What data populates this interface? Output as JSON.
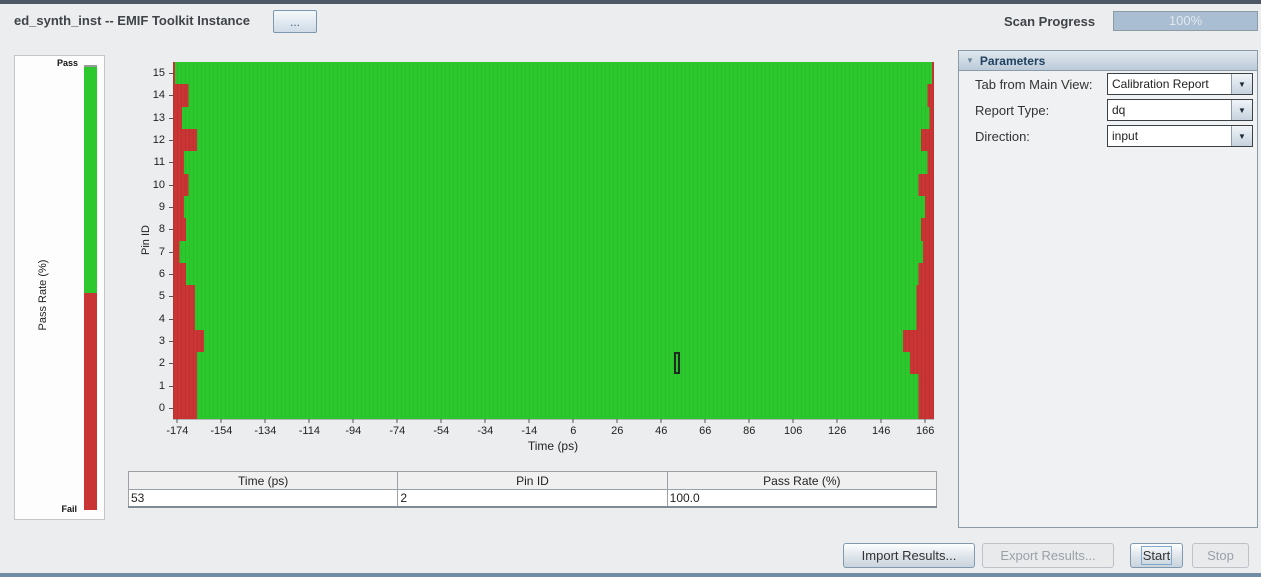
{
  "window": {
    "title": "ed_synth_inst -- EMIF Toolkit Instance",
    "more_button": "...",
    "scan_progress": {
      "label": "Scan Progress",
      "value": "100%",
      "percent": 100
    }
  },
  "legend": {
    "pass_label": "Pass",
    "fail_label": "Fail",
    "axis_label": "Pass Rate (%)",
    "pass_fraction": 0.51
  },
  "chart_data": {
    "type": "heatmap",
    "xlabel": "Time (ps)",
    "ylabel": "Pin ID",
    "x_range": [
      -176,
      170
    ],
    "x_ticks": [
      -174,
      -154,
      -134,
      -114,
      -94,
      -74,
      -54,
      -34,
      -14,
      6,
      26,
      46,
      66,
      86,
      106,
      126,
      146,
      166
    ],
    "colors": {
      "pass": "#2dc82d",
      "fail": "#c93434"
    },
    "series": [
      {
        "pin": 15,
        "pass_start_ps": -175,
        "pass_end_ps": 169
      },
      {
        "pin": 14,
        "pass_start_ps": -169,
        "pass_end_ps": 167
      },
      {
        "pin": 13,
        "pass_start_ps": -172,
        "pass_end_ps": 168
      },
      {
        "pin": 12,
        "pass_start_ps": -165,
        "pass_end_ps": 164
      },
      {
        "pin": 11,
        "pass_start_ps": -171,
        "pass_end_ps": 167
      },
      {
        "pin": 10,
        "pass_start_ps": -169,
        "pass_end_ps": 163
      },
      {
        "pin": 9,
        "pass_start_ps": -171,
        "pass_end_ps": 166
      },
      {
        "pin": 8,
        "pass_start_ps": -170,
        "pass_end_ps": 164
      },
      {
        "pin": 7,
        "pass_start_ps": -173,
        "pass_end_ps": 165
      },
      {
        "pin": 6,
        "pass_start_ps": -170,
        "pass_end_ps": 163
      },
      {
        "pin": 5,
        "pass_start_ps": -166,
        "pass_end_ps": 162
      },
      {
        "pin": 4,
        "pass_start_ps": -166,
        "pass_end_ps": 162
      },
      {
        "pin": 3,
        "pass_start_ps": -162,
        "pass_end_ps": 156
      },
      {
        "pin": 2,
        "pass_start_ps": -165,
        "pass_end_ps": 159
      },
      {
        "pin": 1,
        "pass_start_ps": -165,
        "pass_end_ps": 163
      },
      {
        "pin": 0,
        "pass_start_ps": -165,
        "pass_end_ps": 163
      }
    ],
    "selection": {
      "time_ps": 53,
      "pin_id": 2,
      "pass_rate_pct": "100.0"
    }
  },
  "readout_table": {
    "columns": [
      "Time (ps)",
      "Pin ID",
      "Pass Rate (%)"
    ],
    "row": [
      "53",
      "2",
      "100.0"
    ]
  },
  "parameters": {
    "header": "Parameters",
    "fields": [
      {
        "label": "Tab from Main View:",
        "value": "Calibration Report"
      },
      {
        "label": "Report Type:",
        "value": "dq"
      },
      {
        "label": "Direction:",
        "value": "input"
      }
    ]
  },
  "actions": {
    "import": {
      "label": "Import Results..."
    },
    "export": {
      "label": "Export Results..."
    },
    "start": {
      "label": "Start"
    },
    "stop": {
      "label": "Stop"
    }
  }
}
